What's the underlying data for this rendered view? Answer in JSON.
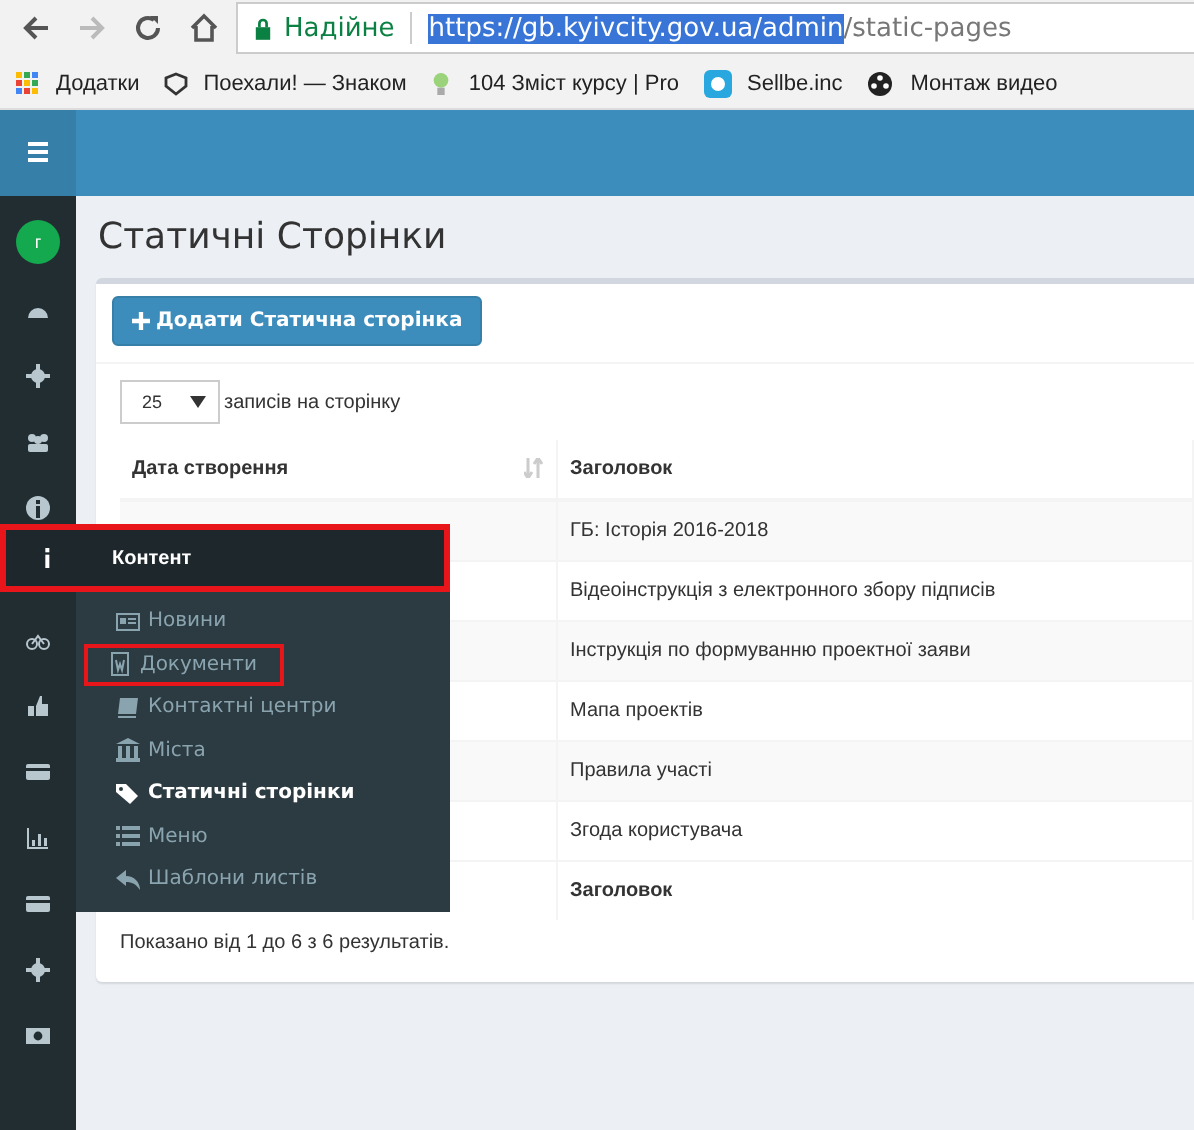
{
  "browser": {
    "secure_label": "Надійне",
    "url_selected": "https://gb.kyivcity.gov.ua/admin",
    "url_rest": "/static-pages",
    "bookmarks": [
      {
        "kind": "apps",
        "label": "Додатки"
      },
      {
        "kind": "shield",
        "label": "Поехали! — Знаком"
      },
      {
        "kind": "bulb",
        "label": "104 Зміст курсу | Pro"
      },
      {
        "kind": "cloud",
        "label": "Sellbe.inc"
      },
      {
        "kind": "reel",
        "label": "Монтаж видео"
      }
    ]
  },
  "sidebar": {
    "avatar": "г",
    "items": [
      {
        "kind": "dashboard",
        "active": false
      },
      {
        "kind": "gear",
        "active": false
      },
      {
        "kind": "users",
        "active": false
      },
      {
        "kind": "info",
        "active": false
      },
      {
        "kind": "info",
        "active": true
      },
      {
        "kind": "bike",
        "active": false
      },
      {
        "kind": "thumb",
        "active": false
      },
      {
        "kind": "card",
        "active": false
      },
      {
        "kind": "chart",
        "active": false
      },
      {
        "kind": "card",
        "active": false
      },
      {
        "kind": "gear",
        "active": false
      },
      {
        "kind": "money",
        "active": false
      }
    ]
  },
  "flyout": {
    "title": "Контент",
    "highlighted": true,
    "items": [
      {
        "kind": "news",
        "label": "Новини",
        "selected": false,
        "highlighted": false
      },
      {
        "kind": "doc",
        "label": "Документи",
        "selected": false,
        "highlighted": true
      },
      {
        "kind": "book",
        "label": "Контактні центри",
        "selected": false,
        "highlighted": false
      },
      {
        "kind": "bank",
        "label": "Міста",
        "selected": false,
        "highlighted": false
      },
      {
        "kind": "tags",
        "label": "Статичні сторінки",
        "selected": true,
        "highlighted": false
      },
      {
        "kind": "list",
        "label": "Меню",
        "selected": false,
        "highlighted": false
      },
      {
        "kind": "reply",
        "label": "Шаблони листів",
        "selected": false,
        "highlighted": false
      }
    ]
  },
  "page_title": "Статичні Сторінки",
  "add_button": "Додати Статична сторінка",
  "page_size": {
    "value": "25",
    "label": "записів на сторінку"
  },
  "table": {
    "columns": [
      "Дата створення",
      "Заголовок"
    ],
    "rows": [
      {
        "title": "ГБ: Історія 2016-2018"
      },
      {
        "title": "Відеоінструкція з електронного збору підписів"
      },
      {
        "title": "Інструкція по формуванню проектної заяви"
      },
      {
        "title": "Мапа проектів"
      },
      {
        "title": "Правила участі"
      },
      {
        "title": "Згода користувача"
      }
    ],
    "footer": [
      "Заголовок"
    ]
  },
  "summary": "Показано від 1 до 6 з 6 результатів."
}
